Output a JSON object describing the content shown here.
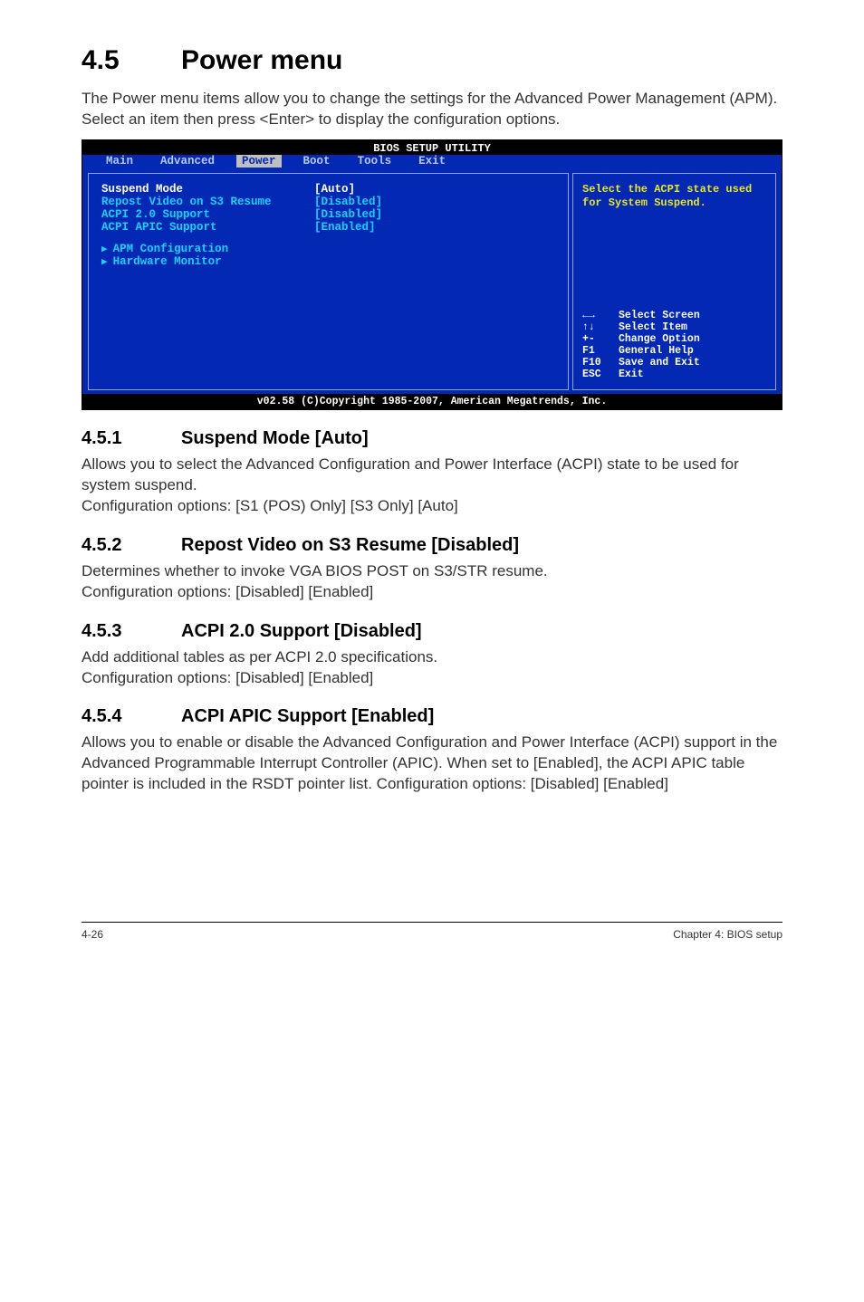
{
  "heading": {
    "number": "4.5",
    "title": "Power menu"
  },
  "intro": "The Power menu items allow you to change the settings for the Advanced Power Management (APM). Select an item then press <Enter> to display the configuration options.",
  "bios": {
    "header": "BIOS SETUP UTILITY",
    "tabs": {
      "main": "Main",
      "advanced": "Advanced",
      "power": "Power",
      "boot": "Boot",
      "tools": "Tools",
      "exit": "Exit"
    },
    "items": [
      {
        "label": "Suspend Mode",
        "value": "[Auto]"
      },
      {
        "label": "Repost Video on S3 Resume",
        "value": "[Disabled]"
      },
      {
        "label": "ACPI 2.0 Support",
        "value": "[Disabled]"
      },
      {
        "label": "ACPI APIC Support",
        "value": "[Enabled]"
      }
    ],
    "submenus": [
      "APM Configuration",
      "Hardware Monitor"
    ],
    "help_top": "Select the ACPI state used for System Suspend.",
    "help_bottom": [
      {
        "key": "←→",
        "action": "Select Screen"
      },
      {
        "key": "↑↓",
        "action": "Select Item"
      },
      {
        "key": "+-",
        "action": "Change Option"
      },
      {
        "key": "F1",
        "action": "General Help"
      },
      {
        "key": "F10",
        "action": "Save and Exit"
      },
      {
        "key": "ESC",
        "action": "Exit"
      }
    ],
    "footer": "v02.58 (C)Copyright 1985-2007, American Megatrends, Inc."
  },
  "sections": [
    {
      "num": "4.5.1",
      "title": "Suspend Mode [Auto]",
      "body": "Allows you to select the Advanced Configuration and Power Interface (ACPI) state to be used for system suspend.\nConfiguration options: [S1 (POS) Only] [S3 Only] [Auto]"
    },
    {
      "num": "4.5.2",
      "title": "Repost Video on S3 Resume [Disabled]",
      "body": "Determines whether to invoke VGA BIOS POST on S3/STR resume.\nConfiguration options: [Disabled] [Enabled]"
    },
    {
      "num": "4.5.3",
      "title": "ACPI 2.0 Support [Disabled]",
      "body": "Add additional tables as per ACPI 2.0 specifications.\nConfiguration options: [Disabled] [Enabled]"
    },
    {
      "num": "4.5.4",
      "title": "ACPI APIC Support [Enabled]",
      "body": "Allows you to enable or disable the Advanced Configuration and Power Interface (ACPI) support in the Advanced Programmable Interrupt Controller (APIC). When set to [Enabled], the ACPI APIC table pointer is included in the RSDT pointer list. Configuration options: [Disabled] [Enabled]"
    }
  ],
  "footer": {
    "left": "4-26",
    "right": "Chapter 4: BIOS setup"
  }
}
